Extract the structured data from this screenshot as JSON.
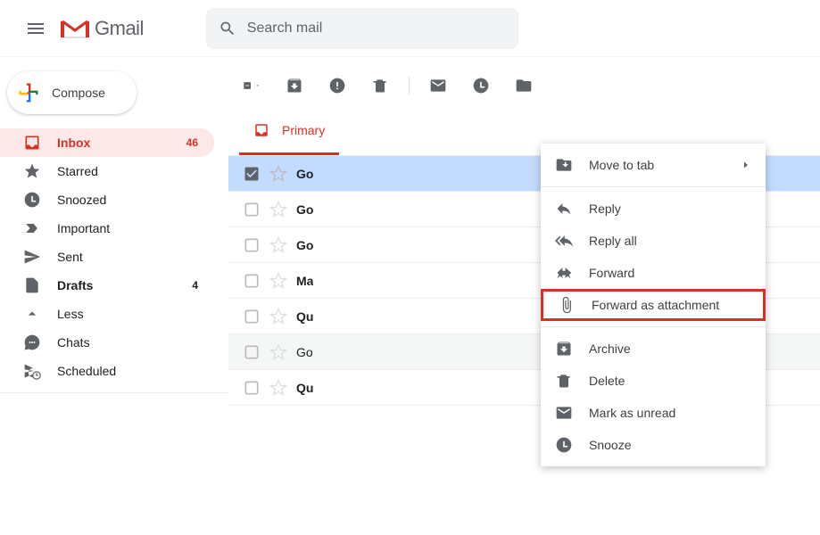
{
  "header": {
    "product_name": "Gmail",
    "search_placeholder": "Search mail"
  },
  "compose_label": "Compose",
  "sidebar": {
    "items": [
      {
        "label": "Inbox",
        "count": "46"
      },
      {
        "label": "Starred",
        "count": ""
      },
      {
        "label": "Snoozed",
        "count": ""
      },
      {
        "label": "Important",
        "count": ""
      },
      {
        "label": "Sent",
        "count": ""
      },
      {
        "label": "Drafts",
        "count": "4"
      },
      {
        "label": "Less",
        "count": ""
      },
      {
        "label": "Chats",
        "count": ""
      },
      {
        "label": "Scheduled",
        "count": ""
      }
    ]
  },
  "tabs": {
    "primary": "Primary"
  },
  "rows": [
    {
      "sender": "Go"
    },
    {
      "sender": "Go"
    },
    {
      "sender": "Go"
    },
    {
      "sender": "Ma"
    },
    {
      "sender": "Qu"
    },
    {
      "sender": "Go"
    },
    {
      "sender": "Qu"
    }
  ],
  "context_menu": {
    "move_to_tab": "Move to tab",
    "reply": "Reply",
    "reply_all": "Reply all",
    "forward": "Forward",
    "forward_as_attachment": "Forward as attachment",
    "archive": "Archive",
    "delete": "Delete",
    "mark_as_unread": "Mark as unread",
    "snooze": "Snooze"
  }
}
